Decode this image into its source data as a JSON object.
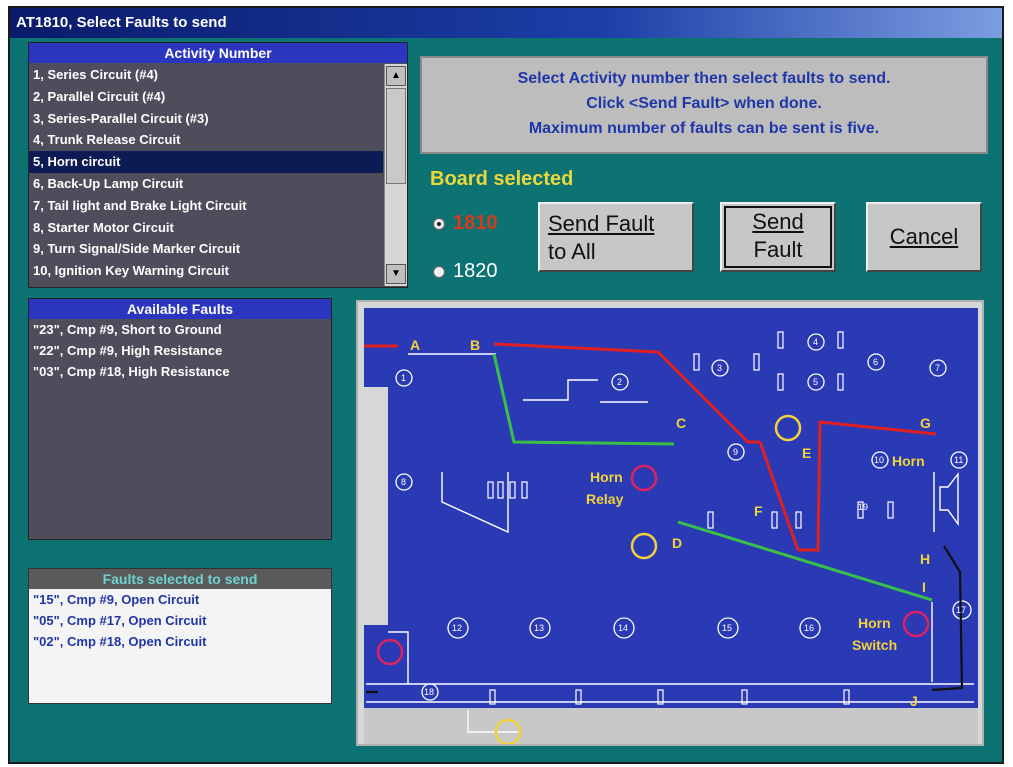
{
  "window": {
    "title": "AT1810, Select Faults to send"
  },
  "activity": {
    "header": "Activity Number",
    "items": [
      "1, Series Circuit (#4)",
      "2, Parallel Circuit (#4)",
      "3, Series-Parallel Circuit (#3)",
      "4, Trunk Release Circuit",
      "5, Horn circuit",
      "6, Back-Up Lamp Circuit",
      "7, Tail light and Brake Light Circuit",
      "8, Starter Motor Circuit",
      "9, Turn Signal/Side Marker Circuit",
      "10, Ignition Key Warning Circuit"
    ],
    "selected_index": 4
  },
  "instructions": {
    "line1": "Select Activity number then select faults to send.",
    "line2": "Click <Send Fault> when done.",
    "line3": "Maximum number of faults can be sent is five."
  },
  "board": {
    "label": "Board selected",
    "option1": "1810",
    "option2": "1820",
    "selected": "1810"
  },
  "buttons": {
    "send_all_line1": "Send Fault",
    "send_all_line2": "to All",
    "send_fault_line1": "Send",
    "send_fault_line2": "Fault",
    "cancel": "Cancel"
  },
  "available_faults": {
    "header": "Available Faults",
    "items": [
      "\"23\", Cmp #9, Short to Ground",
      "\"22\", Cmp #9, High Resistance",
      "\"03\", Cmp #18, High Resistance"
    ]
  },
  "selected_faults": {
    "header": "Faults selected to send",
    "items": [
      "\"15\", Cmp #9, Open Circuit",
      "\"05\", Cmp #17, Open Circuit",
      "\"02\", Cmp #18, Open Circuit"
    ]
  },
  "diagram": {
    "labels": {
      "A": "A",
      "B": "B",
      "C": "C",
      "D": "D",
      "E": "E",
      "F": "F",
      "G": "G",
      "H": "H",
      "I": "I",
      "J": "J",
      "horn_relay_1": "Horn",
      "horn_relay_2": "Relay",
      "horn": "Horn",
      "horn_switch_1": "Horn",
      "horn_switch_2": "Switch"
    },
    "numbers": [
      "1",
      "2",
      "3",
      "4",
      "5",
      "6",
      "7",
      "8",
      "9",
      "10",
      "11",
      "12",
      "13",
      "14",
      "15",
      "16",
      "17",
      "18",
      "19"
    ]
  },
  "colors": {
    "background": "#0c7272",
    "board_blue": "#2a3ab5",
    "wire_red": "#e02020",
    "wire_green": "#38c048",
    "label_yellow": "#f2d23a",
    "fault_marker": "#e02060"
  }
}
